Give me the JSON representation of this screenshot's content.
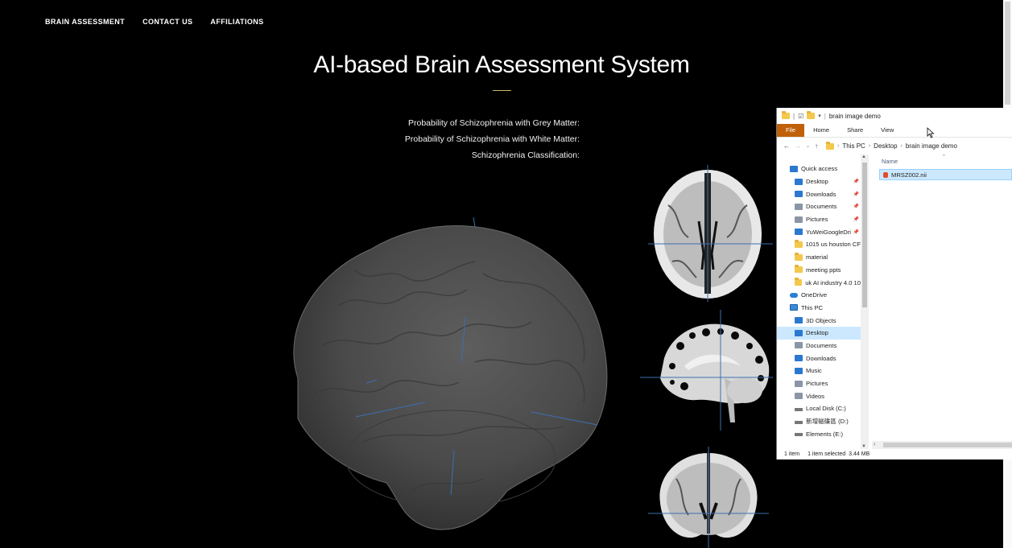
{
  "nav": {
    "items": [
      "BRAIN ASSESSMENT",
      "CONTACT US",
      "AFFILIATIONS"
    ]
  },
  "page": {
    "title": "AI-based Brain Assessment System",
    "results": [
      "Probability of Schizophrenia with Grey Matter:",
      "Probability of Schizophrenia with White Matter:",
      "Schizophrenia Classification:"
    ]
  },
  "explorer": {
    "window_title": "brain image demo",
    "ribbon_tabs": [
      "File",
      "Home",
      "Share",
      "View"
    ],
    "breadcrumb": [
      "This PC",
      "Desktop",
      "brain image demo"
    ],
    "nav_items": [
      {
        "label": "Quick access",
        "icon": "star-icon",
        "section": true,
        "pinned": false
      },
      {
        "label": "Desktop",
        "icon": "desktop-icon",
        "section": false,
        "pinned": true
      },
      {
        "label": "Downloads",
        "icon": "download-icon",
        "section": false,
        "pinned": true
      },
      {
        "label": "Documents",
        "icon": "documents-icon",
        "section": false,
        "pinned": true
      },
      {
        "label": "Pictures",
        "icon": "pictures-icon",
        "section": false,
        "pinned": true
      },
      {
        "label": "YuWeiGoogleDri",
        "icon": "google-drive-icon",
        "section": false,
        "pinned": true
      },
      {
        "label": "1015 us houston CF",
        "icon": "folder-icon",
        "section": false,
        "pinned": false
      },
      {
        "label": "material",
        "icon": "folder-icon",
        "section": false,
        "pinned": false
      },
      {
        "label": "meeting ppts",
        "icon": "folder-icon",
        "section": false,
        "pinned": false
      },
      {
        "label": "uk AI industry 4.0 10",
        "icon": "folder-icon",
        "section": false,
        "pinned": false
      },
      {
        "label": "OneDrive",
        "icon": "onedrive-icon",
        "section": true,
        "pinned": false
      },
      {
        "label": "This PC",
        "icon": "pc-icon",
        "section": true,
        "pinned": false
      },
      {
        "label": "3D Objects",
        "icon": "3d-objects-icon",
        "section": false,
        "pinned": false
      },
      {
        "label": "Desktop",
        "icon": "desktop-icon",
        "section": false,
        "pinned": false,
        "selected": true
      },
      {
        "label": "Documents",
        "icon": "documents-icon",
        "section": false,
        "pinned": false
      },
      {
        "label": "Downloads",
        "icon": "download-icon",
        "section": false,
        "pinned": false
      },
      {
        "label": "Music",
        "icon": "music-icon",
        "section": false,
        "pinned": false
      },
      {
        "label": "Pictures",
        "icon": "pictures-icon",
        "section": false,
        "pinned": false
      },
      {
        "label": "Videos",
        "icon": "videos-icon",
        "section": false,
        "pinned": false
      },
      {
        "label": "Local Disk (C:)",
        "icon": "drive-icon",
        "section": false,
        "pinned": false
      },
      {
        "label": "新增磁碟區 (D:)",
        "icon": "drive-icon",
        "section": false,
        "pinned": false
      },
      {
        "label": "Elements (E:)",
        "icon": "drive-icon",
        "section": false,
        "pinned": false
      }
    ],
    "column_header": "Name",
    "files": [
      "MRSZ002.nii"
    ],
    "status": {
      "count": "1 item",
      "selected": "1 item selected",
      "size": "3.44 MB"
    }
  },
  "colors": {
    "accent_rule": "#c9b56a",
    "file_tab": "#c0600a",
    "selection": "#cce8ff"
  }
}
